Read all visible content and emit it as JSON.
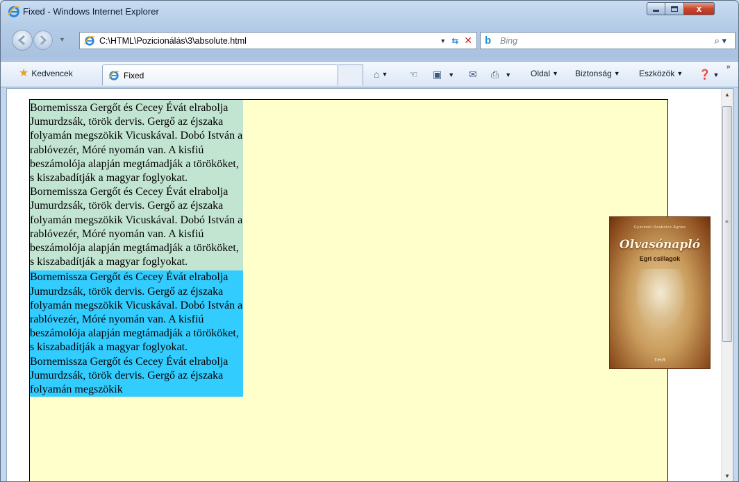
{
  "window": {
    "title": "Fixed - Windows Internet Explorer",
    "close_glyph": "x"
  },
  "address_bar": {
    "url": "C:\\HTML\\Pozicionálás\\3\\absolute.html"
  },
  "search": {
    "placeholder": "Bing"
  },
  "favorites_bar": {
    "favorites_label": "Kedvencek",
    "tab_label": "Fixed"
  },
  "command_bar": {
    "page_label": "Oldal",
    "safety_label": "Biztonság",
    "tools_label": "Eszközök"
  },
  "content": {
    "paragraphs": [
      "Bornemissza Gergőt és Cecey Évát elrabolja Jumurdzsák, török dervis. Gergő az éjszaka folyamán megszökik Vicuskával. Dobó István a rablóvezér, Móré nyomán van. A kisfiú beszámolója alapján megtámadják a törököket, s kiszabadítják a magyar foglyokat.",
      "Bornemissza Gergőt és Cecey Évát elrabolja Jumurdzsák, török dervis. Gergő az éjszaka folyamán megszökik Vicuskával. Dobó István a rablóvezér, Móré nyomán van. A kisfiú beszámolója alapján megtámadják a törököket, s kiszabadítják a magyar foglyokat.",
      "Bornemissza Gergőt és Cecey Évát elrabolja Jumurdzsák, török dervis. Gergő az éjszaka folyamán megszökik Vicuskával. Dobó István a rablóvezér, Móré nyomán van. A kisfiú beszámolója alapján megtámadják a törököket, s kiszabadítják a magyar foglyokat.",
      "Bornemissza Gergőt és Cecey Évát elrabolja Jumurdzsák, török dervis. Gergő az éjszaka folyamán megszökik"
    ],
    "colors": {
      "container_bg": "#ffffcc",
      "green_block": "#c2e5d2",
      "blue_block": "#33ccff"
    }
  },
  "book_cover": {
    "author": "Gyarmati Szabolcs Ágnes",
    "title": "Olvasónapló",
    "subtitle": "Egri csillagok",
    "publisher": "T-H-R"
  }
}
